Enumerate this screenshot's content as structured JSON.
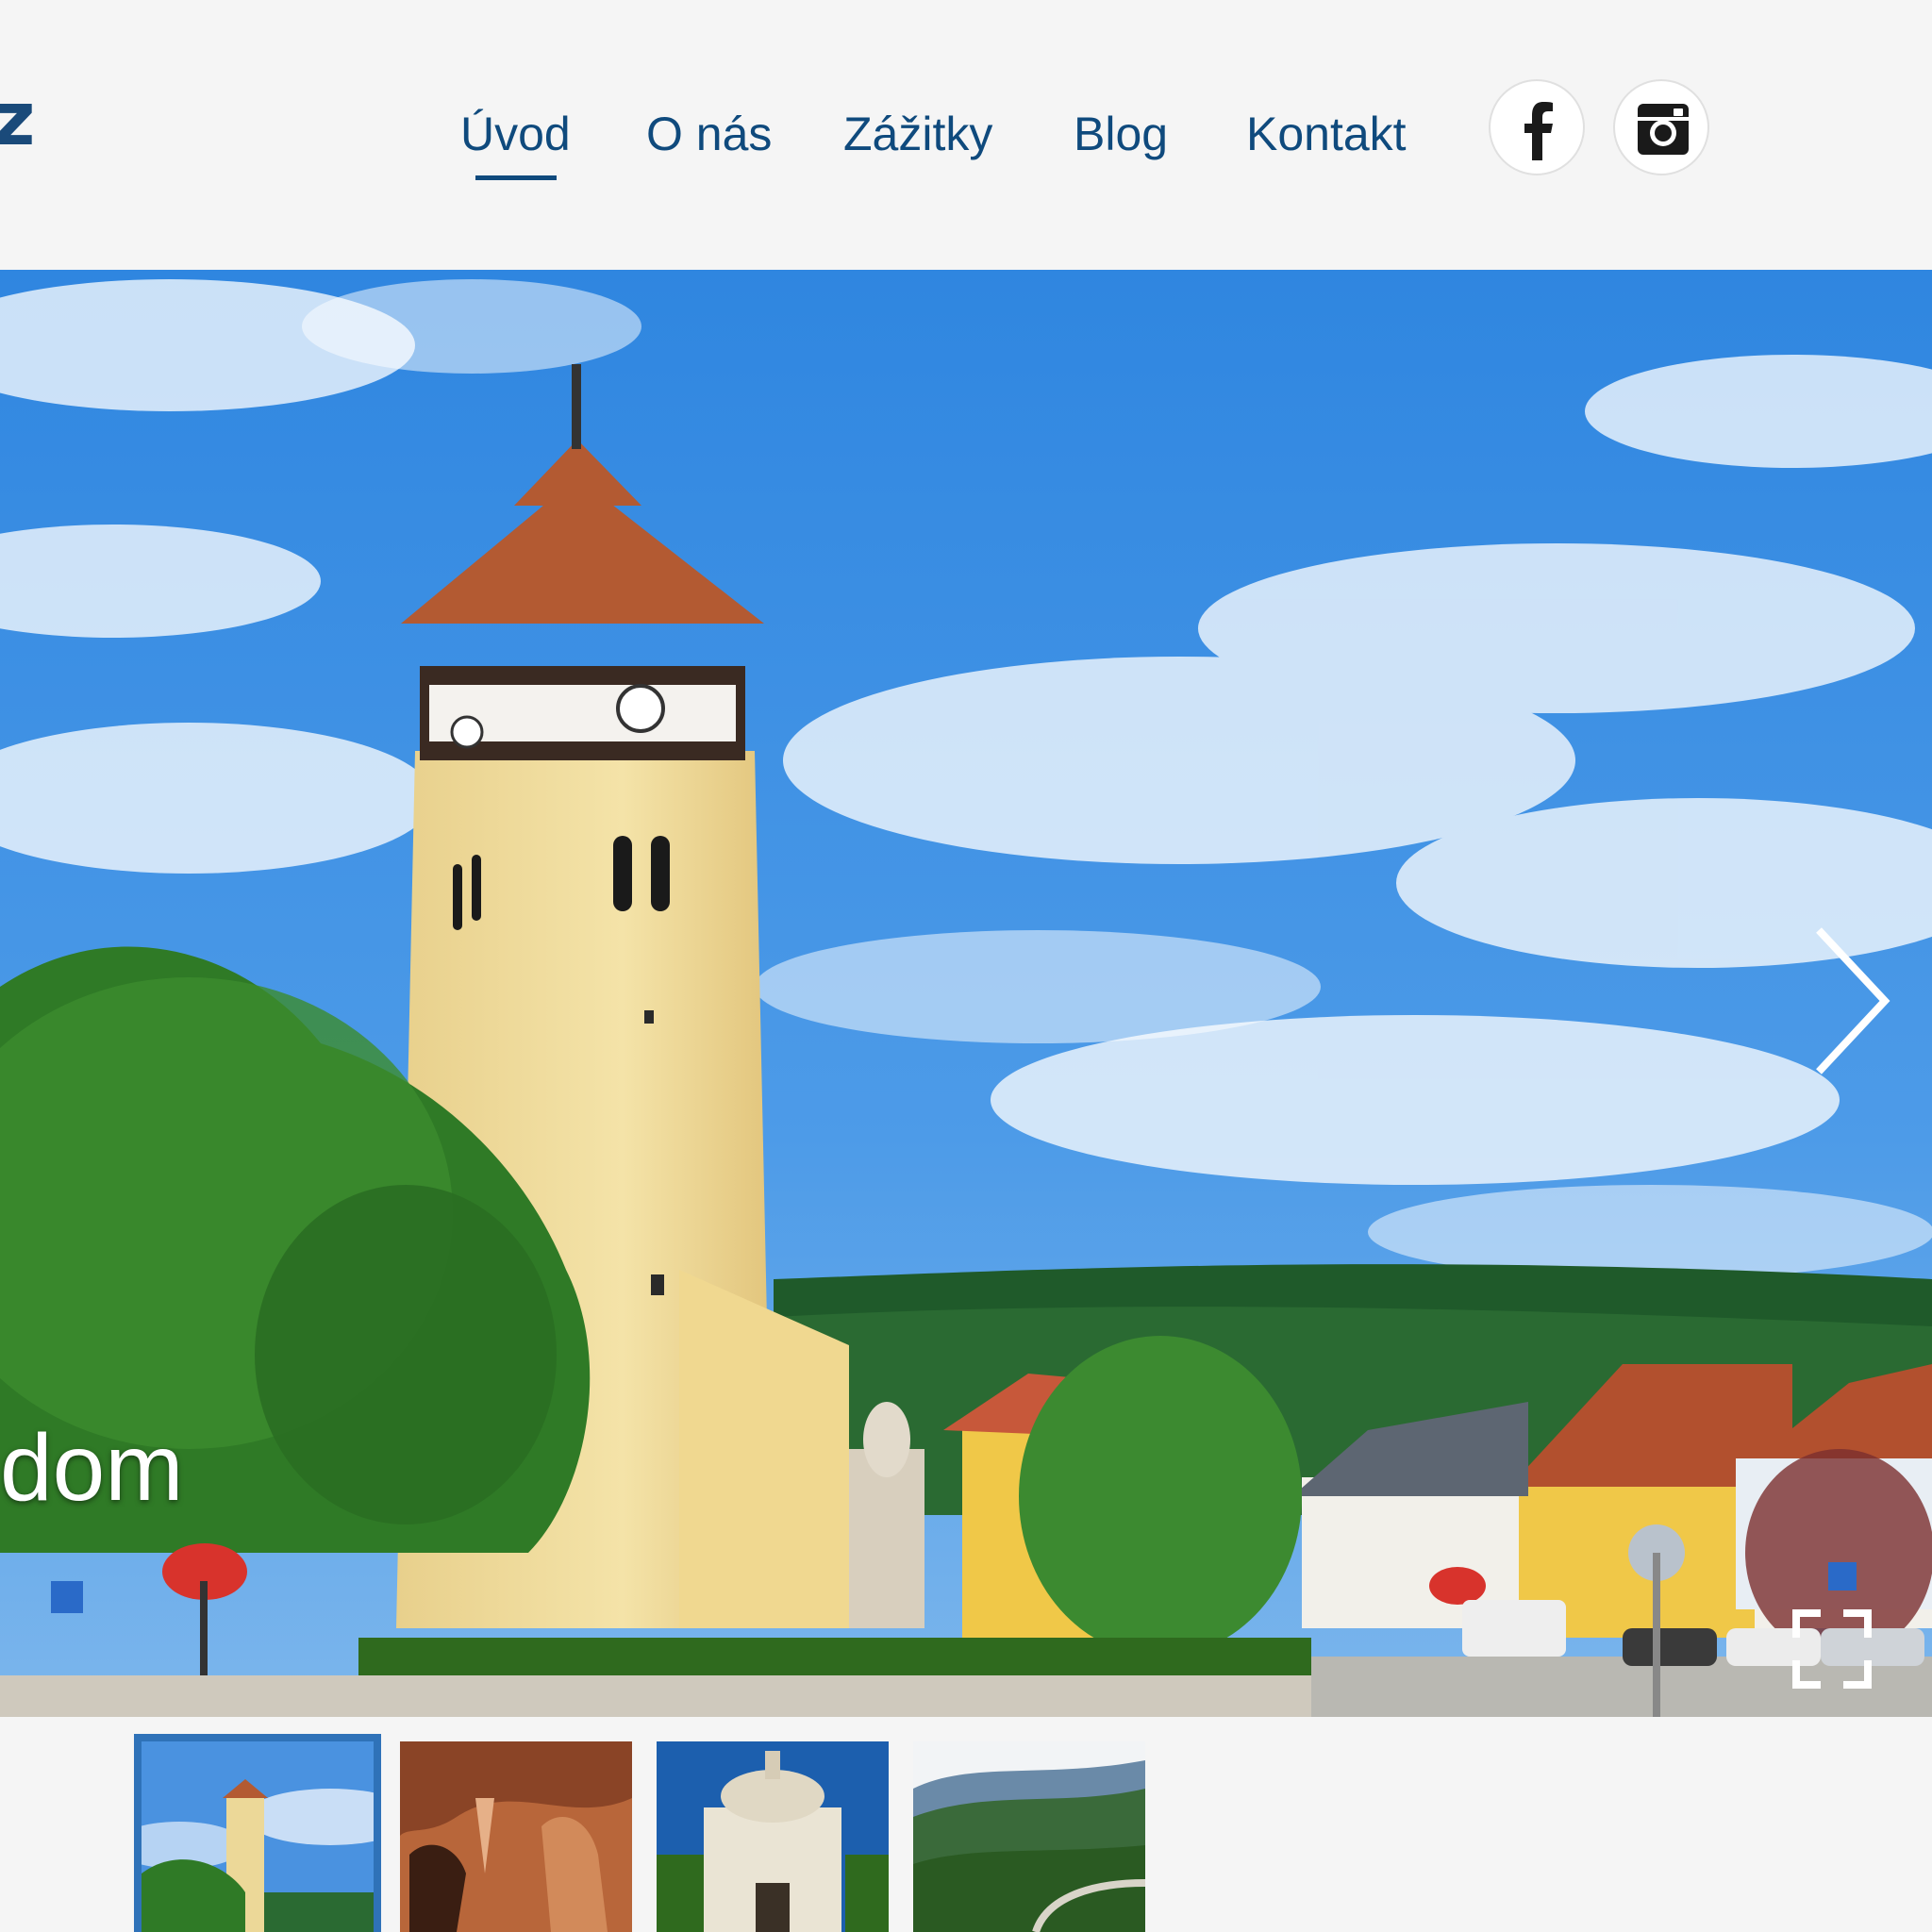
{
  "logo": {
    "fragment": "z"
  },
  "nav": {
    "items": [
      {
        "label": "Úvod",
        "active": true
      },
      {
        "label": "O nás"
      },
      {
        "label": "Zážitky"
      },
      {
        "label": "Blog"
      },
      {
        "label": "Kontakt"
      }
    ],
    "social": [
      {
        "icon": "facebook-icon",
        "glyph": "f"
      },
      {
        "icon": "instagram-icon"
      }
    ]
  },
  "colors": {
    "nav_text": "#0f4a7d",
    "background": "#f5f5f5",
    "thumb_active_border": "#2f72b8"
  },
  "hero": {
    "caption": "dom",
    "next_icon": "chevron-right-icon",
    "fullscreen_icon": "fullscreen-icon"
  },
  "thumbnails": [
    {
      "subject": "tower",
      "active": true
    },
    {
      "subject": "cave"
    },
    {
      "subject": "mausoleum"
    },
    {
      "subject": "hills"
    }
  ]
}
